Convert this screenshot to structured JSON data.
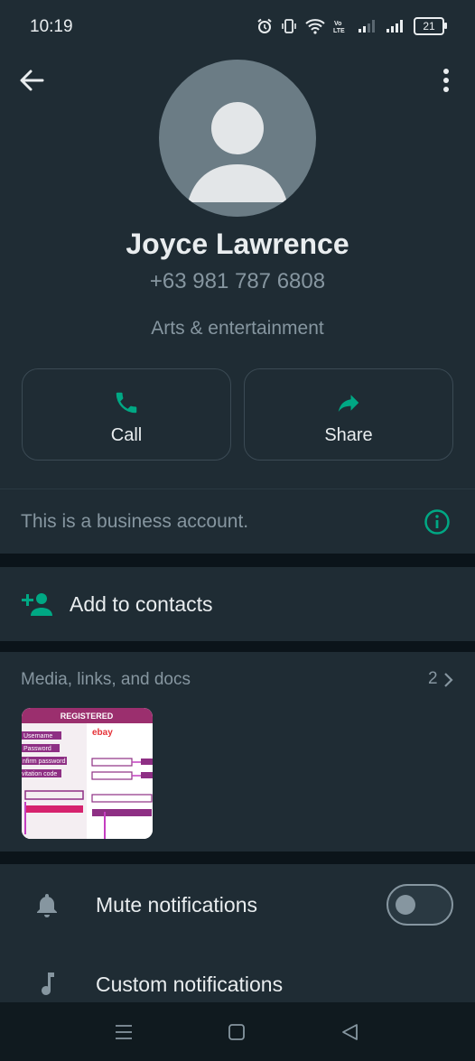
{
  "status_bar": {
    "time": "10:19",
    "battery": "21",
    "icons": [
      "alarm-icon",
      "vibrate-icon",
      "wifi-icon",
      "volte-icon",
      "signal-icon",
      "signal-icon",
      "battery-icon"
    ]
  },
  "header": {
    "name": "Joyce Lawrence",
    "phone": "+63 981 787 6808",
    "category": "Arts & entertainment",
    "actions": [
      {
        "label": "Call",
        "icon": "phone-icon"
      },
      {
        "label": "Share",
        "icon": "share-icon"
      }
    ]
  },
  "business": {
    "text": "This is a business account.",
    "icon": "info-icon"
  },
  "add_contact": {
    "label": "Add to contacts",
    "icon": "add-person-icon"
  },
  "media": {
    "title": "Media, links, and docs",
    "count": "2",
    "thumbnail": {
      "banner": "REGISTERED",
      "brand": "ebay",
      "fields": [
        "Username",
        "Password",
        "nfirm password",
        "vitation code"
      ]
    }
  },
  "notifications": {
    "mute_label": "Mute notifications",
    "mute_enabled": false,
    "custom_label": "Custom notifications"
  },
  "colors": {
    "accent": "#00a884",
    "header_bg": "#1f2c34",
    "page_bg": "#111b21",
    "secondary_text": "#8696a0"
  }
}
